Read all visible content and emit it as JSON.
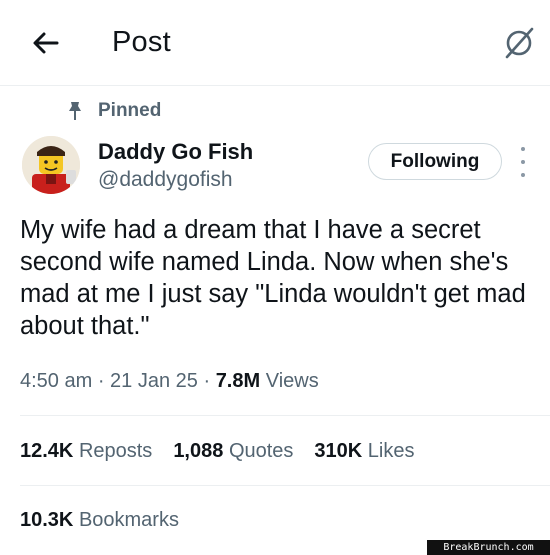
{
  "header": {
    "title": "Post",
    "back_icon": "arrow-left-icon",
    "grok_icon": "grok-icon"
  },
  "post": {
    "pinned_label": "Pinned",
    "author": {
      "name": "Daddy Go Fish",
      "handle": "@daddygofish"
    },
    "follow_button_label": "Following",
    "text": "My wife had a dream that I have a secret second wife named Linda. Now when she's mad at me I just say \"Linda wouldn't get mad about that.\"",
    "time": "4:50 am",
    "date": "21 Jan 25",
    "separator": " · ",
    "views_count": "7.8M",
    "views_label": "Views"
  },
  "stats": {
    "reposts_count": "12.4K",
    "reposts_label": "Reposts",
    "quotes_count": "1,088",
    "quotes_label": "Quotes",
    "likes_count": "310K",
    "likes_label": "Likes",
    "bookmarks_count": "10.3K",
    "bookmarks_label": "Bookmarks"
  },
  "watermark": "BreakBrunch.com",
  "colors": {
    "text_primary": "#0f1419",
    "text_secondary": "#536471",
    "border": "#cfd9de"
  }
}
